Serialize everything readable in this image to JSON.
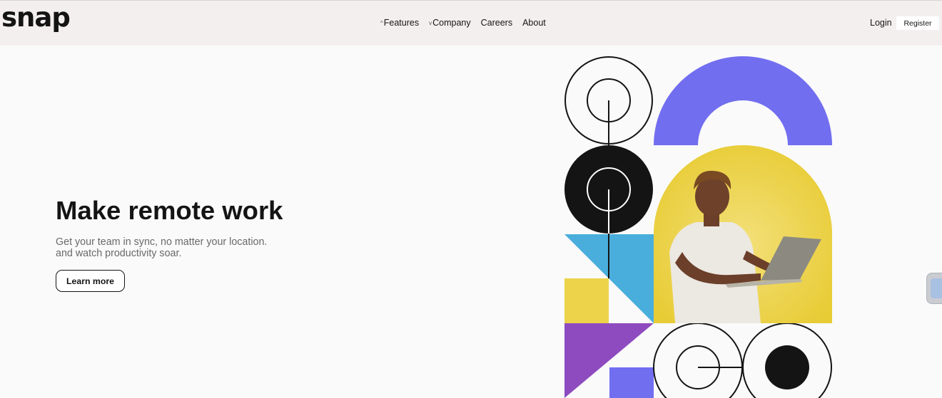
{
  "brand": {
    "logo_text": "snap"
  },
  "nav": {
    "items": [
      {
        "label": "Features",
        "icon": "chevron-up-icon",
        "chevron": "^"
      },
      {
        "label": "Company",
        "icon": "chevron-down-icon",
        "chevron": "v"
      },
      {
        "label": "Careers"
      },
      {
        "label": "About"
      }
    ],
    "login_label": "Login",
    "register_label": "Register"
  },
  "hero": {
    "title": "Make remote work",
    "subtitle": "Get your team in sync, no matter your location. and watch productivity soar.",
    "cta_label": "Learn more"
  },
  "colors": {
    "header_bg": "#f4efef",
    "page_bg": "#fafafa",
    "text": "#141414",
    "muted_text": "#696969",
    "purple": "#726ef0",
    "yellow": "#ecd34a",
    "cyan": "#4aaedc",
    "violet": "#8e4bbf",
    "black": "#141414"
  },
  "icons": [
    "chevron-up-icon",
    "chevron-down-icon",
    "side-widget-icon"
  ]
}
